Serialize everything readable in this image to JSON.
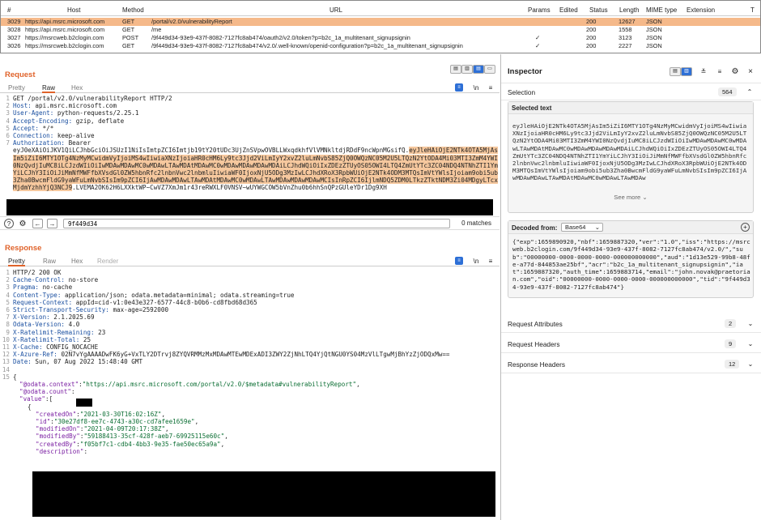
{
  "table": {
    "headers": [
      "#",
      "Host",
      "Method",
      "URL",
      "Params",
      "Edited",
      "Status",
      "Length",
      "MIME type",
      "Extension",
      "T"
    ],
    "rows": [
      {
        "n": "3029",
        "host": "https://api.msrc.microsoft.com",
        "method": "GET",
        "url": "/portal/v2.0/vulnerabilityReport",
        "params": "",
        "status": "200",
        "length": "12627",
        "mime": "JSON",
        "selected": true
      },
      {
        "n": "3028",
        "host": "https://api.msrc.microsoft.com",
        "method": "GET",
        "url": "/me",
        "params": "",
        "status": "200",
        "length": "1558",
        "mime": "JSON",
        "selected": false
      },
      {
        "n": "3027",
        "host": "https://msrcweb.b2clogin.com",
        "method": "POST",
        "url": "/9f449d34-93e9-437f-8082-7127fc8ab474/oauth2/v2.0/token?p=b2c_1a_multitenant_signupsignin",
        "params": "✓",
        "status": "200",
        "length": "3123",
        "mime": "JSON",
        "selected": false
      },
      {
        "n": "3026",
        "host": "https://msrcweb.b2clogin.com",
        "method": "GET",
        "url": "/9f449d34-93e9-437f-8082-7127fc8ab474/v2.0/.well-known/openid-configuration?p=b2c_1a_multitenant_signupsignin",
        "params": "✓",
        "status": "200",
        "length": "2227",
        "mime": "JSON",
        "selected": false
      }
    ]
  },
  "request": {
    "title": "Request",
    "tabs": [
      "Pretty",
      "Raw",
      "Hex"
    ],
    "active_tab": "Raw",
    "lines": [
      {
        "n": "1",
        "text": "GET /portal/v2.0/vulnerabilityReport HTTP/2"
      },
      {
        "n": "2",
        "k": "Host:",
        "v": " api.msrc.microsoft.com"
      },
      {
        "n": "3",
        "k": "User-Agent:",
        "v": " python-requests/2.25.1"
      },
      {
        "n": "4",
        "k": "Accept-Encoding:",
        "v": " gzip, deflate"
      },
      {
        "n": "5",
        "k": "Accept:",
        "v": " */*"
      },
      {
        "n": "6",
        "k": "Connection:",
        "v": " keep-alive"
      },
      {
        "n": "7",
        "k": "Authorization:",
        "v": " Bearer"
      }
    ],
    "auth_plain": "eyJ0eXAiOiJKV1QiLCJhbGciOiJSUzI1NiIsImtpZCI6Imtjb19tY20tUDc3UjZnSVpwOVBLLWxqdkhfVlVMNkltdjRDdF9ncWpnMGsifQ.",
    "auth_hl_1": "eyJleHAiOjE2NTk4OTA",
    "auth_hl_rest": "5MjAsIm5iZiI6MTY1OTg4NzMyMCwidmVyIjoiMS4wIiwiaXNzIjoiaHR0cHM6Ly9tc3Jjd2ViLmIyY2xvZ2luLmNvbS85ZjQ0OWQzNC05M2U5LTQzN2YtODA4Mi03MTI3ZmM4YWI0NzQvdjIuMC8iLCJzdWIiOiIwMDAwMDAwMC0wMDAwLTAwMDAtMDAwMC0wMDAwMDAwMDAwMDAiLCJhdWQiOiIxZDEzZTUyOS05OWI4LTQ4ZmUtYTc3ZC04NDQ4NTNhZTI1YmYiLCJhY3IiOiJiMmNfMWFfbXVsdGl0ZW5hbnRfc2lnbnVwc2lnbmluIiwiaWF0IjoxNjU5ODg3MzIwLCJhdXRoX3RpbWUiOjE2NTk4ODM3MTQsImVtYWlsIjoiam9obi5ub3Zha0BwcmFldG9yaWFuLmNvbSIsIm9pZCI6IjAwMDAwMDAwLTAwMDAtMDAwMC0wMDAwLTAwMDAwMDAwMDAwMCIsInRpZCI6IjlmNDQ5ZDM0LTkzZTktNDM3Zi04MDgyLTcxMjdmYzhhYjQ3NCJ9",
    "auth_tail": ".LVEMA2OK62H6LXXktWP~CwVZ7XmJm1r43reRWXLF0VNSV~wUYWGCOW5bVnZhu0b6hhSnQPzGUleYDr1Dg9XH",
    "search_value": "9f449d34",
    "matches": "0 matches"
  },
  "response": {
    "title": "Response",
    "tabs": [
      "Pretty",
      "Raw",
      "Hex",
      "Render"
    ],
    "active_tab": "Pretty",
    "headers": [
      {
        "n": "1",
        "text": "HTTP/2 200 OK"
      },
      {
        "n": "2",
        "k": "Cache-Control:",
        "v": " no-store"
      },
      {
        "n": "3",
        "k": "Pragma:",
        "v": " no-cache"
      },
      {
        "n": "4",
        "k": "Content-Type:",
        "v": " application/json; odata.metadata=minimal; odata.streaming=true"
      },
      {
        "n": "5",
        "k": "Request-Context:",
        "v": " appId=cid-v1:0e43e327-6577-44c8-b0b6-cd8fbd68d365"
      },
      {
        "n": "6",
        "k": "Strict-Transport-Security:",
        "v": " max-age=2592000"
      },
      {
        "n": "7",
        "k": "X-Version:",
        "v": " 2.1.2025.69"
      },
      {
        "n": "8",
        "k": "Odata-Version:",
        "v": " 4.0"
      },
      {
        "n": "9",
        "k": "X-Ratelimit-Remaining:",
        "v": " 23"
      },
      {
        "n": "10",
        "k": "X-Ratelimit-Total:",
        "v": " 25"
      },
      {
        "n": "11",
        "k": "X-Cache:",
        "v": " CONFIG_NOCACHE"
      },
      {
        "n": "12",
        "k": "X-Azure-Ref:",
        "v": " 02N7vYgAAAADwFK6yG+VxTLY2DTrvj8ZYQVRMMzMxMDAwMTEwMDExADI3ZWY2ZjNhLTQ4YjQtNGU0YS04MzVlLTgwMjBhYzZjODQxMw=="
      },
      {
        "n": "13",
        "k": "Date:",
        "v": " Sun, 07 Aug 2022 15:48:40 GMT"
      },
      {
        "n": "14",
        "text": ""
      },
      {
        "n": "15",
        "text": "{"
      }
    ],
    "context_key": "\"@odata.context\"",
    "context_val": "\"https://api.msrc.microsoft.com/portal/v2.0/$metadata#vulnerabilityReport\"",
    "count_key": "\"@odata.count\"",
    "value_key": "\"value\"",
    "fields": [
      {
        "key": "\"createdOn\"",
        "val": "\"2021-03-30T16:02:16Z\""
      },
      {
        "key": "\"id\"",
        "val": "\"30e27df8-ee7c-4743-a30c-cd7afee1659e\""
      },
      {
        "key": "\"modifiedOn\"",
        "val": "\"2021-04-09T20:17:38Z\""
      },
      {
        "key": "\"modifiedBy\"",
        "val": "\"59188413-35cf-428f-aeb7-69925115e60c\""
      },
      {
        "key": "\"createdBy\"",
        "val": "\"f05bf7c1-cdb4-4bb3-9e35-fae50ec65a9a\""
      },
      {
        "key": "\"description\"",
        "val": ""
      }
    ]
  },
  "inspector": {
    "title": "Inspector",
    "selection_label": "Selection",
    "selection_count": "564",
    "selected_text_label": "Selected text",
    "selected_text": "eyJleHAiOjE2NTk4OTA5MjAsIm5iZiI6MTY1OTg4NzMyMCwidmVyIjoiMS4wIiwiaXNzIjoiaHR0cHM6Ly9tc3Jjd2ViLmIyY2xvZ2luLmNvbS85ZjQ0OWQzNC05M2U5LTQzN2YtODA4Mi03MTI3ZmM4YWI0NzQvdjIuMC8iLCJzdWIiOiIwMDAwMDAwMC0wMDAwLTAwMDAtMDAwMC0wMDAwMDAwMDAwMDAiLCJhdWQiOiIxZDEzZTUyOS05OWI4LTQ4ZmUtYTc3ZC04NDQ4NTNhZTI1YmYiLCJhY3IiOiJiMmNfMWFfbXVsdGl0ZW5hbnRfc2lnbnVwc2lnbmluIiwiaWF0IjoxNjU5ODg3MzIwLCJhdXRoX3RpbWUiOjE2NTk4ODM3MTQsImVtYWlsIjoiam9obi5ub3Zha0BwcmFldG9yaWFuLmNvbSIsIm9pZCI6IjAwMDAwMDAwLTAwMDAtMDAwMC0wMDAwLTAwMDAw",
    "see_more": "See more",
    "decoded_from_label": "Decoded from:",
    "decoded_from_value": "Base64",
    "decoded_text": "{\"exp\":1659890920,\"nbf\":1659887320,\"ver\":\"1.0\",\"iss\":\"https://msrcweb.b2clogin.com/9f449d34-93e9-437f-8082-7127fc8ab474/v2.0/\",\"sub\":\"00000000-0000-0000-0000-000000000000\",\"aud\":\"1d13e529-99b8-48fe-a77d-844853ae25bf\",\"acr\":\"b2c_1a_multitenant_signupsignin\",\"iat\":1659887320,\"auth_time\":1659883714,\"email\":\"john.novak@praetorian.com\",\"oid\":\"00000000-0000-0000-0000-000000000000\",\"tid\":\"9f449d34-93e9-437f-8082-7127fc8ab474\"}",
    "sections": [
      {
        "label": "Request Attributes",
        "count": "2"
      },
      {
        "label": "Request Headers",
        "count": "9"
      },
      {
        "label": "Response Headers",
        "count": "12"
      }
    ]
  },
  "colors": {
    "accent": "#e0632b",
    "selected_row": "#f5b98a",
    "highlight": "#f6c89e"
  }
}
